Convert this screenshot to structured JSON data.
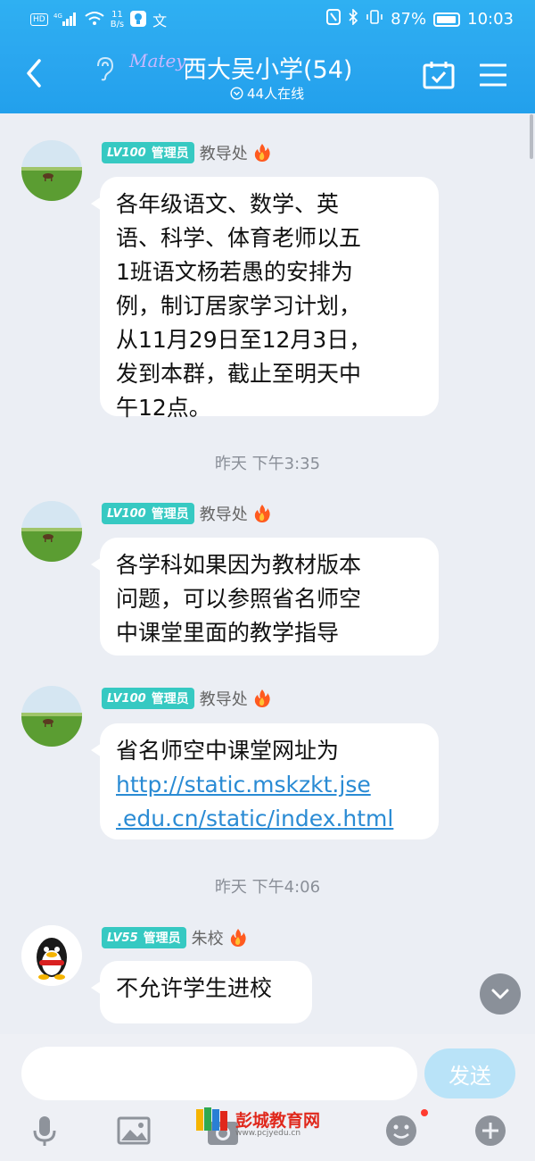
{
  "status_bar": {
    "network_speed": "11\nB/s",
    "hd": "HD",
    "net_type": "4G",
    "battery": "87%",
    "time": "10:03"
  },
  "header": {
    "logo_text": "Matey",
    "title": "西大吴小学(54)",
    "online": "44人在线"
  },
  "messages": [
    {
      "level": "LV100",
      "role": "管理员",
      "sender": "教导处",
      "lines": [
        "各年级语文、数学、英",
        "语、科学、体育老师以五",
        "1班语文杨若愚的安排为",
        "例，制订居家学习计划，",
        "从11月29日至12月3日，",
        "发到本群，截止至明天中",
        "午12点。"
      ]
    },
    {
      "level": "LV100",
      "role": "管理员",
      "sender": "教导处",
      "lines": [
        "各学科如果因为教材版本",
        "问题，可以参照省名师空",
        "中课堂里面的教学指导"
      ]
    },
    {
      "level": "LV100",
      "role": "管理员",
      "sender": "教导处",
      "lines": [
        "省名师空中课堂网址为"
      ],
      "link_lines": [
        "http://static.mskzkt.jse",
        ".edu.cn/static/index.html"
      ]
    },
    {
      "level": "LV55",
      "role": "管理员",
      "sender": "朱校",
      "lines": [
        "不允许学生进校"
      ]
    }
  ],
  "timestamps": [
    "昨天 下午3:35",
    "昨天 下午4:06"
  ],
  "input": {
    "placeholder": "",
    "send_label": "发送"
  },
  "watermark": {
    "text": "彭城教育网",
    "sub": "www.pcjyedu.cn"
  },
  "icons": [
    "voice-icon",
    "image-icon",
    "camera-icon",
    "emoji-icon",
    "plus-icon"
  ]
}
